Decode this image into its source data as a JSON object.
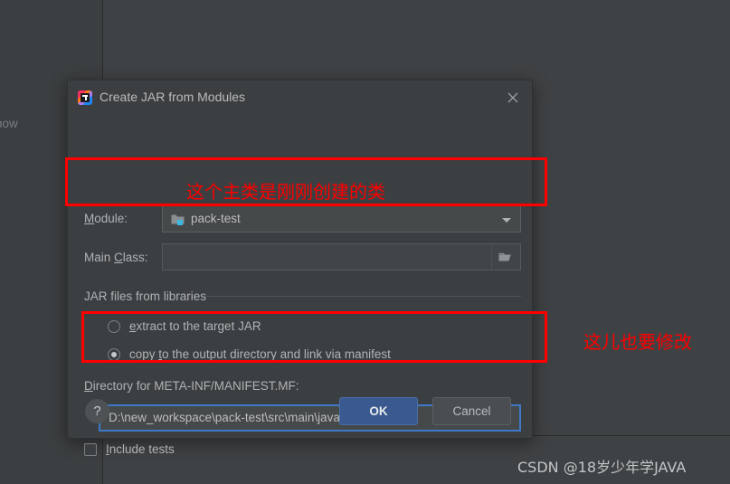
{
  "background": {
    "empty_panel_text": "g to show"
  },
  "dialog": {
    "title": "Create JAR from Modules",
    "logo_icon": "intellij-idea-logo-icon",
    "close_icon": "close-icon",
    "module": {
      "label": "Module:",
      "mnemonic": "M",
      "label_rest": "odule:",
      "value": "pack-test",
      "folder_icon": "module-folder-icon",
      "arrow_icon": "chevron-down-icon"
    },
    "main_class": {
      "label_pre": "Main ",
      "mnemonic": "C",
      "label_rest": "lass:",
      "value": "",
      "browse_icon": "folder-browse-icon"
    },
    "jar_group": {
      "label": "JAR files from libraries",
      "options": [
        {
          "label_pre": "",
          "mnemonic": "e",
          "label_rest": "xtract to the target JAR",
          "checked": false
        },
        {
          "label_pre": "copy ",
          "mnemonic": "t",
          "label_rest": "o the output directory and link via manifest",
          "checked": true
        }
      ]
    },
    "directory": {
      "label_pre": "",
      "mnemonic": "D",
      "label_rest": "irectory for META-INF/MANIFEST.MF:",
      "value": "D:\\new_workspace\\pack-test\\src\\main\\java",
      "browse_icon": "folder-browse-icon"
    },
    "include_tests": {
      "mnemonic": "I",
      "label_rest": "nclude tests",
      "checked": false
    },
    "footer": {
      "help_label": "?",
      "ok_label": "OK",
      "cancel_label": "Cancel"
    }
  },
  "annotations": {
    "main_class_note": "这个主类是刚刚创建的类",
    "directory_note": "这儿也要修改",
    "box_color": "#fe0000"
  },
  "watermark": {
    "text": "CSDN @18岁少年学JAVA"
  },
  "colors": {
    "dialog_bg": "#3c3f41",
    "panel_bg": "#3f4244",
    "accent_blue": "#3f78c6",
    "ok_button": "#39598f",
    "annotation_red": "#fe0000"
  }
}
